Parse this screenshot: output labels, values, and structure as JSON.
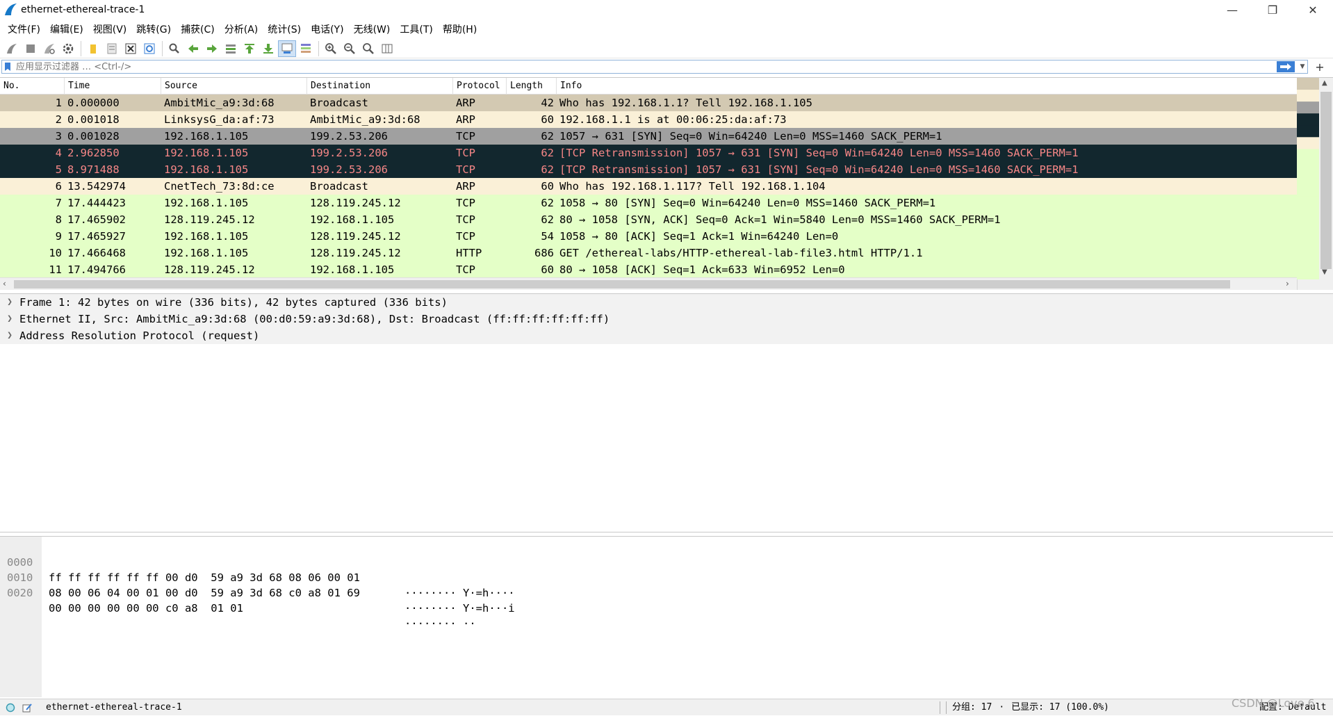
{
  "window": {
    "title": "ethernet-ethereal-trace-1",
    "minimize": "—",
    "restore": "❐",
    "close": "✕"
  },
  "menu": [
    "文件(F)",
    "编辑(E)",
    "视图(V)",
    "跳转(G)",
    "捕获(C)",
    "分析(A)",
    "统计(S)",
    "电话(Y)",
    "无线(W)",
    "工具(T)",
    "帮助(H)"
  ],
  "filter": {
    "placeholder": "应用显示过滤器 … <Ctrl-/>",
    "plus": "+"
  },
  "packet_list": {
    "columns": [
      "No.",
      "Time",
      "Source",
      "Destination",
      "Protocol",
      "Length",
      "Info"
    ],
    "rows": [
      {
        "no": "1",
        "time": "0.000000",
        "src": "AmbitMic_a9:3d:68",
        "dst": "Broadcast",
        "proto": "ARP",
        "len": "42",
        "info": "Who has 192.168.1.1? Tell 192.168.1.105",
        "style": "row-arp-sel"
      },
      {
        "no": "2",
        "time": "0.001018",
        "src": "LinksysG_da:af:73",
        "dst": "AmbitMic_a9:3d:68",
        "proto": "ARP",
        "len": "60",
        "info": "192.168.1.1 is at 00:06:25:da:af:73",
        "style": "row-arp"
      },
      {
        "no": "3",
        "time": "0.001028",
        "src": "192.168.1.105",
        "dst": "199.2.53.206",
        "proto": "TCP",
        "len": "62",
        "info": "1057 → 631 [SYN] Seq=0 Win=64240 Len=0 MSS=1460 SACK_PERM=1",
        "style": "row-tcp-gray"
      },
      {
        "no": "4",
        "time": "2.962850",
        "src": "192.168.1.105",
        "dst": "199.2.53.206",
        "proto": "TCP",
        "len": "62",
        "info": "[TCP Retransmission] 1057 → 631 [SYN] Seq=0 Win=64240 Len=0 MSS=1460 SACK_PERM=1",
        "style": "row-bad"
      },
      {
        "no": "5",
        "time": "8.971488",
        "src": "192.168.1.105",
        "dst": "199.2.53.206",
        "proto": "TCP",
        "len": "62",
        "info": "[TCP Retransmission] 1057 → 631 [SYN] Seq=0 Win=64240 Len=0 MSS=1460 SACK_PERM=1",
        "style": "row-bad"
      },
      {
        "no": "6",
        "time": "13.542974",
        "src": "CnetTech_73:8d:ce",
        "dst": "Broadcast",
        "proto": "ARP",
        "len": "60",
        "info": "Who has 192.168.1.117? Tell 192.168.1.104",
        "style": "row-arp"
      },
      {
        "no": "7",
        "time": "17.444423",
        "src": "192.168.1.105",
        "dst": "128.119.245.12",
        "proto": "TCP",
        "len": "62",
        "info": "1058 → 80 [SYN] Seq=0 Win=64240 Len=0 MSS=1460 SACK_PERM=1",
        "style": "row-tcp"
      },
      {
        "no": "8",
        "time": "17.465902",
        "src": "128.119.245.12",
        "dst": "192.168.1.105",
        "proto": "TCP",
        "len": "62",
        "info": "80 → 1058 [SYN, ACK] Seq=0 Ack=1 Win=5840 Len=0 MSS=1460 SACK_PERM=1",
        "style": "row-tcp"
      },
      {
        "no": "9",
        "time": "17.465927",
        "src": "192.168.1.105",
        "dst": "128.119.245.12",
        "proto": "TCP",
        "len": "54",
        "info": "1058 → 80 [ACK] Seq=1 Ack=1 Win=64240 Len=0",
        "style": "row-tcp"
      },
      {
        "no": "10",
        "time": "17.466468",
        "src": "192.168.1.105",
        "dst": "128.119.245.12",
        "proto": "HTTP",
        "len": "686",
        "info": "GET /ethereal-labs/HTTP-ethereal-lab-file3.html HTTP/1.1",
        "style": "row-http"
      },
      {
        "no": "11",
        "time": "17.494766",
        "src": "128.119.245.12",
        "dst": "192.168.1.105",
        "proto": "TCP",
        "len": "60",
        "info": "80 → 1058 [ACK] Seq=1 Ack=633 Win=6952 Len=0",
        "style": "row-tcp"
      }
    ]
  },
  "details": [
    "Frame 1: 42 bytes on wire (336 bits), 42 bytes captured (336 bits)",
    "Ethernet II, Src: AmbitMic_a9:3d:68 (00:d0:59:a9:3d:68), Dst: Broadcast (ff:ff:ff:ff:ff:ff)",
    "Address Resolution Protocol (request)"
  ],
  "bytes": [
    {
      "offset": "0000",
      "hex": "ff ff ff ff ff ff 00 d0  59 a9 3d 68 08 06 00 01",
      "ascii": "········ Y·=h····"
    },
    {
      "offset": "0010",
      "hex": "08 00 06 04 00 01 00 d0  59 a9 3d 68 c0 a8 01 69",
      "ascii": "········ Y·=h···i"
    },
    {
      "offset": "0020",
      "hex": "00 00 00 00 00 00 c0 a8  01 01",
      "ascii": "········ ··"
    }
  ],
  "status": {
    "file": "ethernet-ethereal-trace-1",
    "packets": "分组: 17",
    "displayed": "已显示: 17 (100.0%)",
    "dot": "·",
    "profile": "配置: Default",
    "watermark": "CSDN @Love 6"
  }
}
